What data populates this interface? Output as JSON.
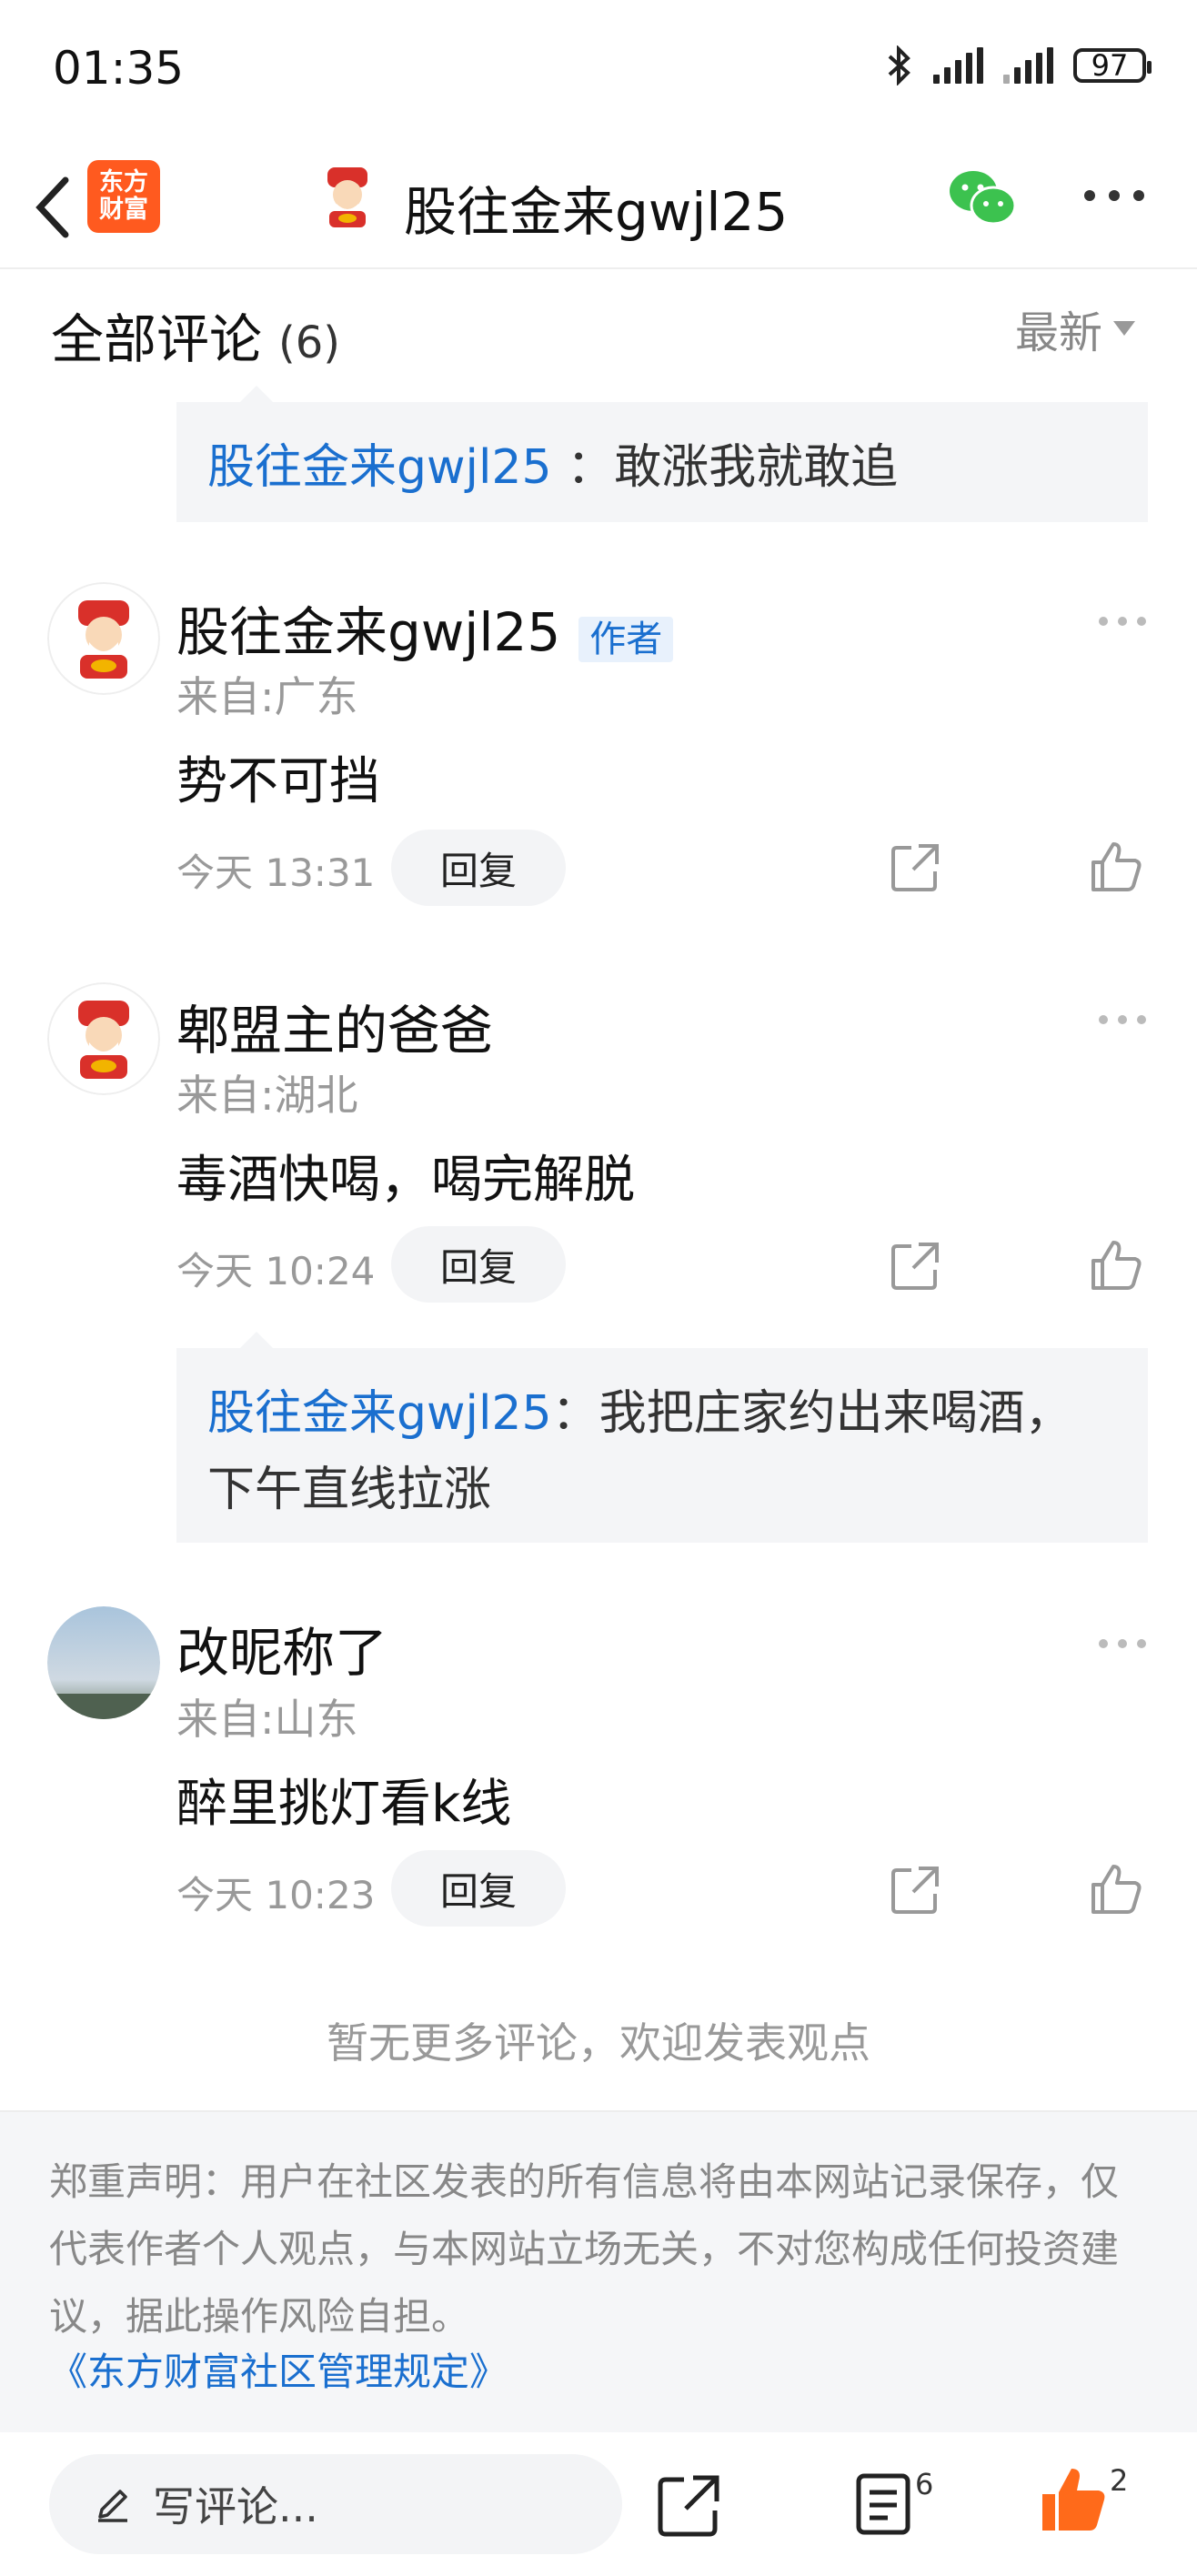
{
  "status_bar": {
    "time": "01:35",
    "battery": "97"
  },
  "header": {
    "brand_line1": "东方",
    "brand_line2": "财富",
    "title": "股往金来gwjl25"
  },
  "section": {
    "title": "全部评论",
    "count": "(6)",
    "sort_label": "最新"
  },
  "quotes": [
    {
      "name": "股往金来gwjl25",
      "text": "：敢涨我就敢追"
    },
    {
      "name": "股往金来gwjl25",
      "text": "：我把庄家约出来喝酒，下午直线拉涨"
    }
  ],
  "comments": [
    {
      "username": "股往金来gwjl25",
      "tag": "作者",
      "location": "来自:广东",
      "content": "势不可挡",
      "time": "今天 13:31",
      "reply": "回复"
    },
    {
      "username": "郫盟主的爸爸",
      "location": "来自:湖北",
      "content": "毒酒快喝，喝完解脱",
      "time": "今天 10:24",
      "reply": "回复"
    },
    {
      "username": "改昵称了",
      "location": "来自:山东",
      "content": "醉里挑灯看k线",
      "time": "今天 10:23",
      "reply": "回复"
    }
  ],
  "no_more": "暂无更多评论，欢迎发表观点",
  "disclaimer": {
    "text": "郑重声明：用户在社区发表的所有信息将由本网站记录保存，仅代表作者个人观点，与本网站立场无关，不对您构成任何投资建议，据此操作风险自担。",
    "link": "《东方财富社区管理规定》"
  },
  "bottom_bar": {
    "input_placeholder": "写评论...",
    "list_badge": "6",
    "like_badge": "2"
  },
  "colors": {
    "accent_blue": "#1a6fcf",
    "brand_orange": "#ff5a1f",
    "like_orange": "#ff6a1a",
    "wechat_green": "#3cc24f"
  }
}
